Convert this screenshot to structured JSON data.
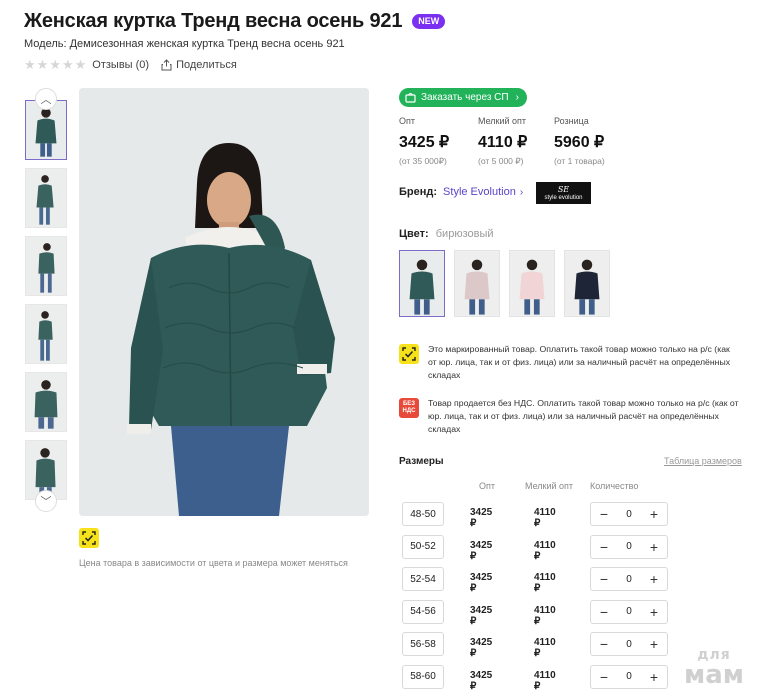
{
  "product": {
    "title": "Женская куртка Тренд весна осень 921",
    "badge": "NEW",
    "model": "Модель: Демисезонная женская куртка Тренд весна осень 921",
    "reviews": "Отзывы (0)",
    "share": "Поделиться",
    "rating_stars": 0
  },
  "gallery": {
    "thumb_count": 6,
    "price_note": "Цена товара в зависимости от цвета и размера может меняться"
  },
  "order": {
    "label": "Заказать через СП"
  },
  "prices": [
    {
      "label": "Опт",
      "value": "3425 ₽",
      "sub": "(от 35 000₽)"
    },
    {
      "label": "Мелкий опт",
      "value": "4110 ₽",
      "sub": "(от 5 000 ₽)"
    },
    {
      "label": "Розница",
      "value": "5960 ₽",
      "sub": "(от 1 товара)"
    }
  ],
  "brand": {
    "label": "Бренд:",
    "name": "Style Evolution",
    "logo_line1": "SE",
    "logo_line2": "style evolution"
  },
  "color": {
    "label": "Цвет:",
    "value": "бирюзовый"
  },
  "swatches": [
    "teal",
    "pink-grey",
    "light-pink",
    "navy"
  ],
  "notices": [
    {
      "icon": "marking-icon",
      "text": "Это маркированный товар. Оплатить такой товар можно только на р/с (как от юр. лица, так и от физ. лица) или за наличный расчёт на определённых складах"
    },
    {
      "icon": "no-vat-icon",
      "icon_text": "БЕЗ НДС",
      "text": "Товар продается без НДС. Оплатить такой товар можно только на р/с (как от юр. лица, так и от физ. лица) или за наличный расчёт на определённых складах"
    }
  ],
  "sizes": {
    "title": "Размеры",
    "table_link": "Таблица размеров",
    "headers": {
      "opt": "Опт",
      "small_opt": "Мелкий опт",
      "qty": "Количество"
    },
    "rows": [
      {
        "size": "48-50",
        "opt": "3425 ₽",
        "small_opt": "4110 ₽",
        "qty": "0"
      },
      {
        "size": "50-52",
        "opt": "3425 ₽",
        "small_opt": "4110 ₽",
        "qty": "0"
      },
      {
        "size": "52-54",
        "opt": "3425 ₽",
        "small_opt": "4110 ₽",
        "qty": "0"
      },
      {
        "size": "54-56",
        "opt": "3425 ₽",
        "small_opt": "4110 ₽",
        "qty": "0"
      },
      {
        "size": "56-58",
        "opt": "3425 ₽",
        "small_opt": "4110 ₽",
        "qty": "0"
      },
      {
        "size": "58-60",
        "opt": "3425 ₽",
        "small_opt": "4110 ₽",
        "qty": "0"
      }
    ],
    "minus": "−",
    "plus": "+"
  },
  "watermark": {
    "line1": "для",
    "line2": "мам"
  },
  "colors": {
    "accent": "#7b2ff0",
    "brand_link": "#5c43c9",
    "order_green": "#22b35a",
    "marking_yellow": "#f5e21b",
    "no_vat_red": "#e84a3a"
  }
}
